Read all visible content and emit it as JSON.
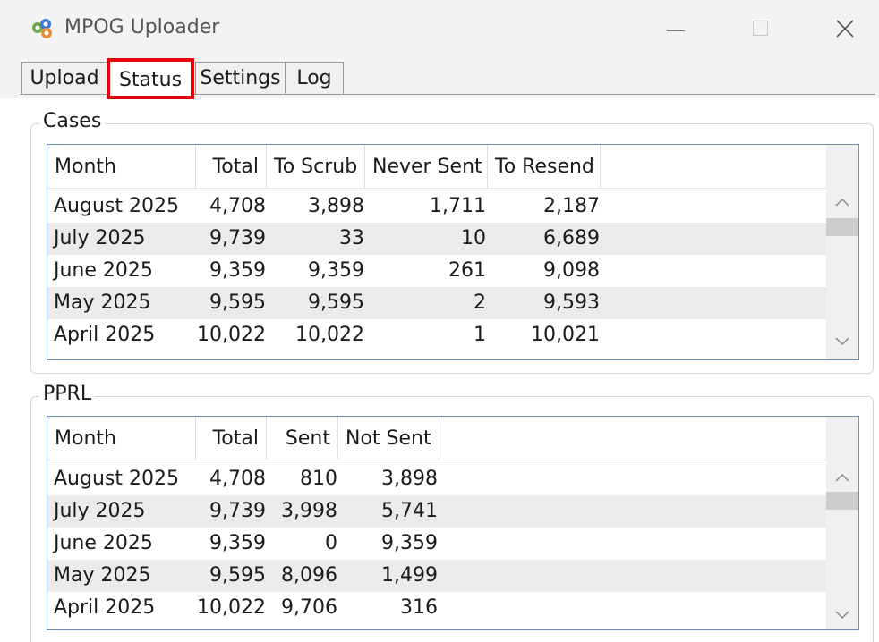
{
  "window": {
    "title": "MPOG Uploader"
  },
  "tabs": [
    {
      "label": "Upload"
    },
    {
      "label": "Status"
    },
    {
      "label": "Settings"
    },
    {
      "label": "Log"
    }
  ],
  "cases": {
    "group_label": "Cases",
    "columns": [
      "Month",
      "Total",
      "To Scrub",
      "Never Sent",
      "To Resend"
    ],
    "rows": [
      [
        "August 2025",
        "4,708",
        "3,898",
        "1,711",
        "2,187"
      ],
      [
        "July 2025",
        "9,739",
        "33",
        "10",
        "6,689"
      ],
      [
        "June 2025",
        "9,359",
        "9,359",
        "261",
        "9,098"
      ],
      [
        "May 2025",
        "9,595",
        "9,595",
        "2",
        "9,593"
      ],
      [
        "April 2025",
        "10,022",
        "10,022",
        "1",
        "10,021"
      ]
    ]
  },
  "pprl": {
    "group_label": "PPRL",
    "columns": [
      "Month",
      "Total",
      "Sent",
      "Not Sent"
    ],
    "rows": [
      [
        "August 2025",
        "4,708",
        "810",
        "3,898"
      ],
      [
        "July 2025",
        "9,739",
        "3,998",
        "5,741"
      ],
      [
        "June 2025",
        "9,359",
        "0",
        "9,359"
      ],
      [
        "May 2025",
        "9,595",
        "8,096",
        "1,499"
      ],
      [
        "April 2025",
        "10,022",
        "9,706",
        "316"
      ]
    ]
  },
  "icons": {
    "app": "mpog-app-icon",
    "minimize": "minimize-icon",
    "maximize": "maximize-icon",
    "close": "close-icon",
    "scroll_up": "chevron-up-icon",
    "scroll_down": "chevron-down-icon"
  },
  "colors": {
    "highlight": "#e5000a",
    "listview_border": "#6e8fb5",
    "alt_row": "#ebebeb"
  }
}
